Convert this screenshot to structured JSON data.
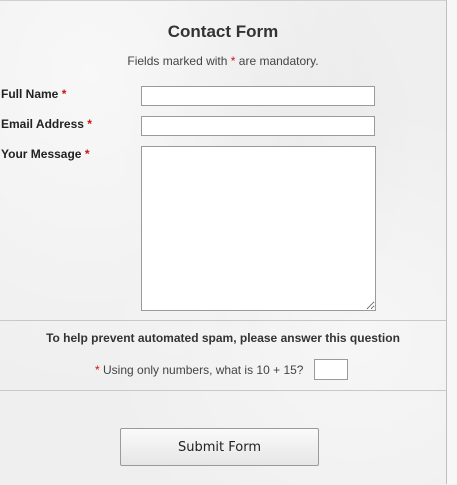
{
  "form": {
    "title": "Contact Form",
    "note_prefix": "Fields marked with ",
    "note_asterisk": "*",
    "note_suffix": " are mandatory.",
    "fields": {
      "full_name": {
        "label": "Full Name",
        "required_mark": "*",
        "value": ""
      },
      "email": {
        "label": "Email Address",
        "required_mark": "*",
        "value": ""
      },
      "message": {
        "label": "Your Message",
        "required_mark": "*",
        "value": ""
      }
    },
    "spam": {
      "heading": "To help prevent automated spam, please answer this question",
      "required_mark": "*",
      "question": "Using only numbers, what is 10 + 15?",
      "answer": ""
    },
    "submit_label": "Submit Form"
  },
  "colors": {
    "required": "#cc1111",
    "background": "#efefef",
    "border": "#9a9a9a"
  }
}
